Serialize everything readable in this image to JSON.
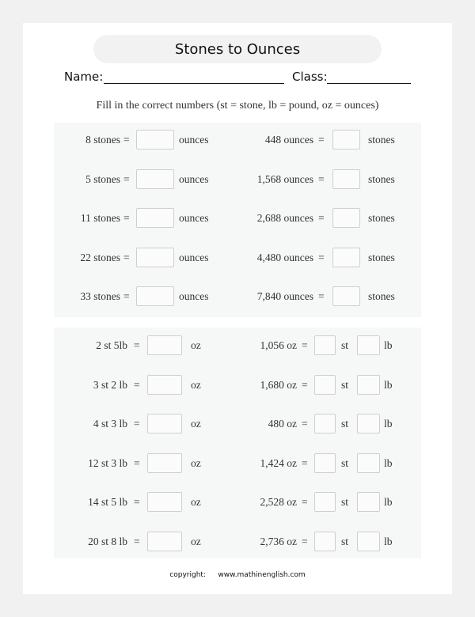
{
  "worksheet": {
    "title": "Stones to Ounces",
    "name_label": "Name:",
    "class_label": "Class:",
    "instructions": "Fill in the correct numbers (st = stone, lb = pound, oz = ounces)",
    "copyright_label": "copyright:",
    "copyright_site": "www.mathinenglish.com"
  },
  "equals": "=",
  "section1": {
    "left": [
      {
        "given": "8 stones",
        "unit": "ounces",
        "answer": ""
      },
      {
        "given": "5 stones",
        "unit": "ounces",
        "answer": ""
      },
      {
        "given": "11 stones",
        "unit": "ounces",
        "answer": ""
      },
      {
        "given": "22 stones",
        "unit": "ounces",
        "answer": ""
      },
      {
        "given": "33 stones",
        "unit": "ounces",
        "answer": ""
      }
    ],
    "right": [
      {
        "given": "448 ounces",
        "unit": "stones",
        "answer": ""
      },
      {
        "given": "1,568 ounces",
        "unit": "stones",
        "answer": ""
      },
      {
        "given": "2,688 ounces",
        "unit": "stones",
        "answer": ""
      },
      {
        "given": "4,480 ounces",
        "unit": "stones",
        "answer": ""
      },
      {
        "given": "7,840 ounces",
        "unit": "stones",
        "answer": ""
      }
    ]
  },
  "section2": {
    "left": [
      {
        "given": "2 st 5lb",
        "unit": "oz",
        "answer": ""
      },
      {
        "given": "3 st 2 lb",
        "unit": "oz",
        "answer": ""
      },
      {
        "given": "4 st 3 lb",
        "unit": "oz",
        "answer": ""
      },
      {
        "given": "12 st 3 lb",
        "unit": "oz",
        "answer": ""
      },
      {
        "given": "14 st 5 lb",
        "unit": "oz",
        "answer": ""
      },
      {
        "given": "20 st 8 lb",
        "unit": "oz",
        "answer": ""
      }
    ],
    "right": [
      {
        "given": "1,056 oz",
        "unit1": "st",
        "unit2": "lb",
        "answer_st": "",
        "answer_lb": ""
      },
      {
        "given": "1,680 oz",
        "unit1": "st",
        "unit2": "lb",
        "answer_st": "",
        "answer_lb": ""
      },
      {
        "given": "480 oz",
        "unit1": "st",
        "unit2": "lb",
        "answer_st": "",
        "answer_lb": ""
      },
      {
        "given": "1,424 oz",
        "unit1": "st",
        "unit2": "lb",
        "answer_st": "",
        "answer_lb": ""
      },
      {
        "given": "2,528 oz",
        "unit1": "st",
        "unit2": "lb",
        "answer_st": "",
        "answer_lb": ""
      },
      {
        "given": "2,736 oz",
        "unit1": "st",
        "unit2": "lb",
        "answer_st": "",
        "answer_lb": ""
      }
    ]
  }
}
